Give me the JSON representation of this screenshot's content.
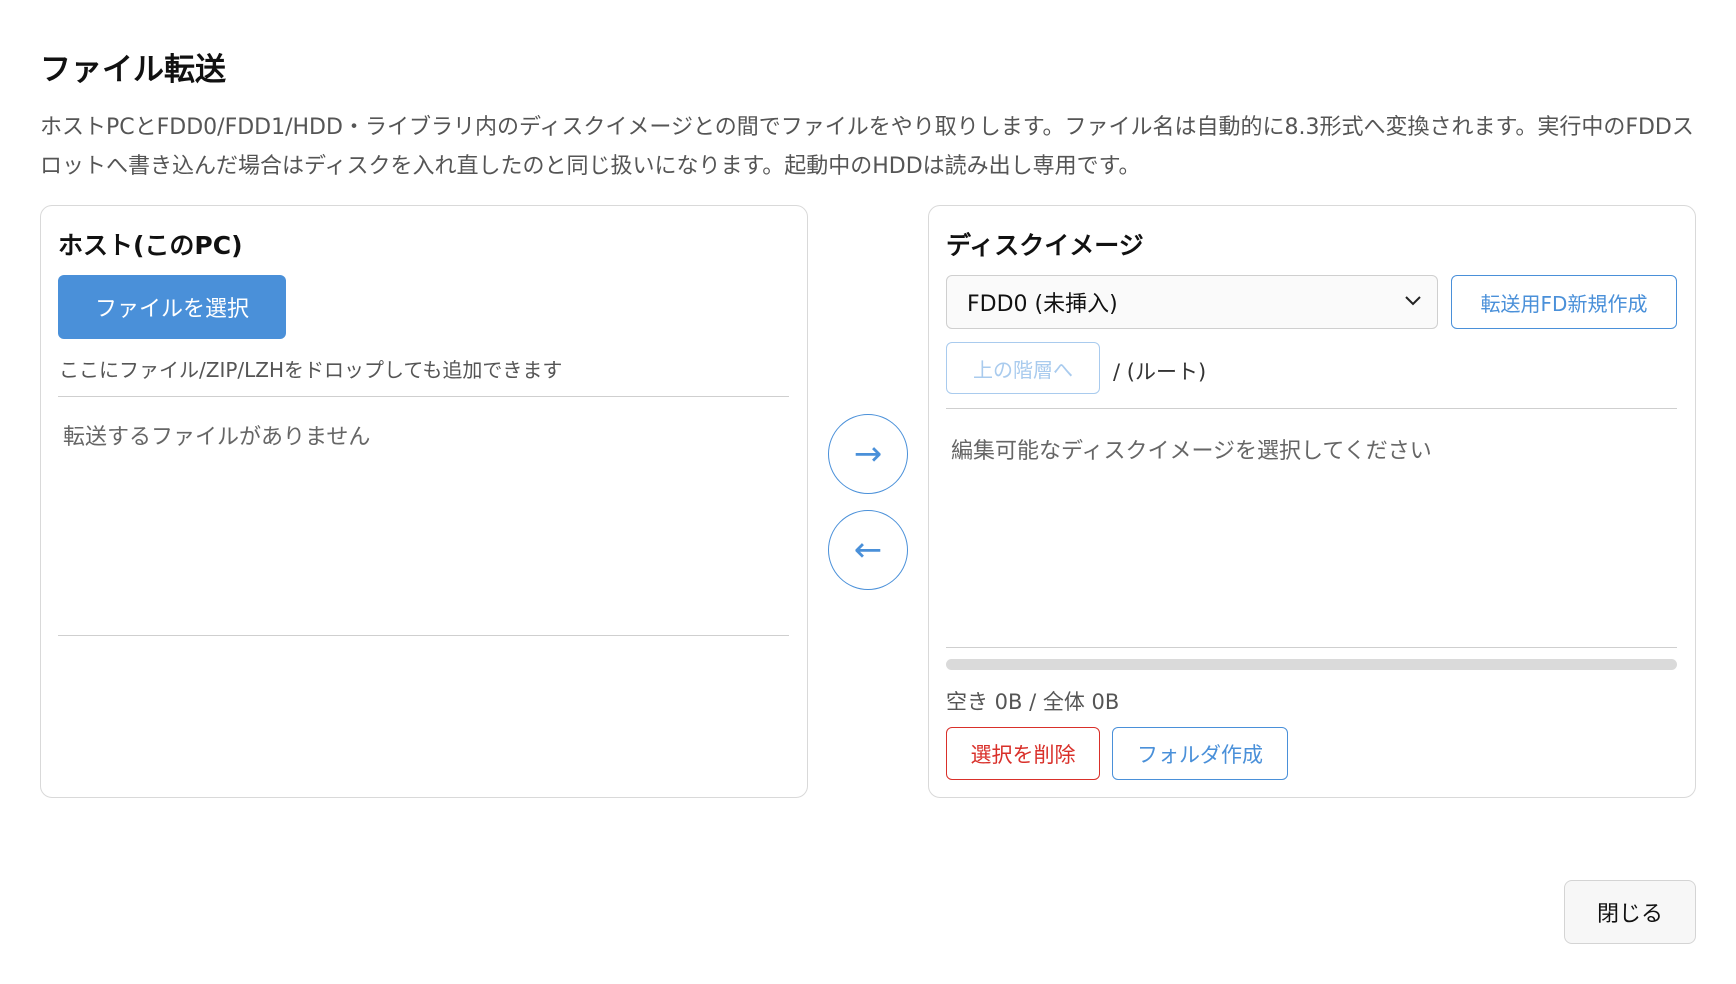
{
  "dialog": {
    "title": "ファイル転送",
    "description": "ホストPCとFDD0/FDD1/HDD・ライブラリ内のディスクイメージとの間でファイルをやり取りします。ファイル名は自動的に8.3形式へ変換されます。実行中のFDDスロットへ書き込んだ場合はディスクを入れ直したのと同じ扱いになります。起動中のHDDは読み出し専用です。",
    "close_label": "閉じる"
  },
  "host": {
    "heading": "ホスト(このPC)",
    "choose_file_label": "ファイルを選択",
    "drop_hint": "ここにファイル/ZIP/LZHをドロップしても追加できます",
    "empty_text": "転送するファイルがありません"
  },
  "transfer": {
    "to_disk_symbol": "→",
    "to_host_symbol": "←"
  },
  "disk": {
    "heading": "ディスクイメージ",
    "selected_image": "FDD0 (未挿入)",
    "new_fd_label": "転送用FD新規作成",
    "up_label": "上の階層へ",
    "path": "/ (ルート)",
    "empty_text": "編集可能なディスクイメージを選択してください",
    "usage_text": "空き 0B / 全体 0B",
    "usage_fraction": 0,
    "delete_label": "選択を削除",
    "new_folder_label": "フォルダ作成"
  },
  "colors": {
    "accent": "#4a90d9",
    "danger": "#d9302a",
    "disabled": "#a9cbee"
  },
  "icons": {
    "select_chevron": "chevron-down-icon",
    "to_disk": "arrow-right-icon",
    "to_host": "arrow-left-icon"
  }
}
